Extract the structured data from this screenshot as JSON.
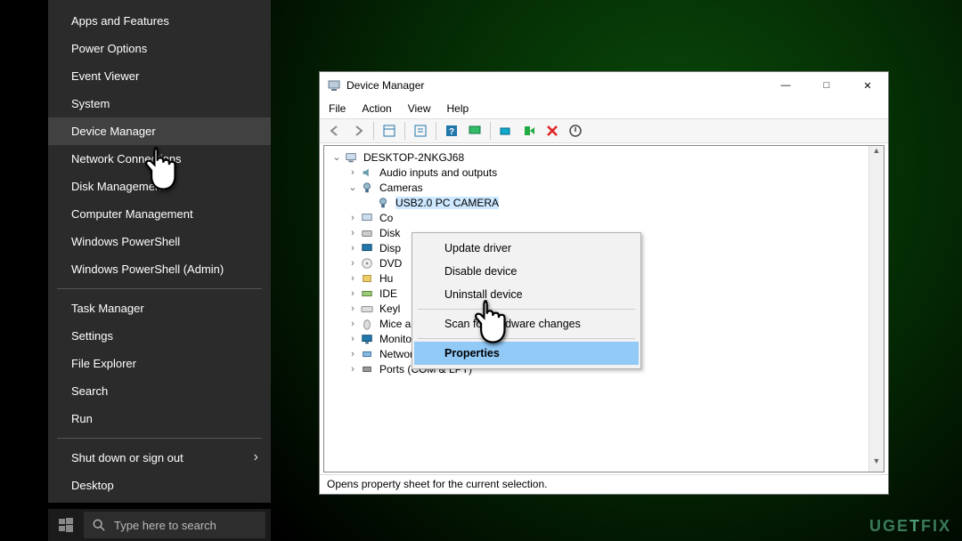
{
  "winx": {
    "items": [
      "Apps and Features",
      "Power Options",
      "Event Viewer",
      "System",
      "Device Manager",
      "Network Connections",
      "Disk Management",
      "Computer Management",
      "Windows PowerShell",
      "Windows PowerShell (Admin)"
    ],
    "group2": [
      "Task Manager",
      "Settings",
      "File Explorer",
      "Search",
      "Run"
    ],
    "group3": [
      "Shut down or sign out",
      "Desktop"
    ],
    "hovered_index": 4
  },
  "taskbar": {
    "search_placeholder": "Type here to search"
  },
  "dm": {
    "title": "Device Manager",
    "menu": [
      "File",
      "Action",
      "View",
      "Help"
    ],
    "root": "DESKTOP-2NKGJ68",
    "nodes": [
      {
        "label": "Audio inputs and outputs",
        "exp": "closed",
        "icon": "audio"
      },
      {
        "label": "Cameras",
        "exp": "open",
        "icon": "camera",
        "children": [
          {
            "label": "USB2.0 PC CAMERA",
            "icon": "camera",
            "selected": true
          }
        ]
      },
      {
        "label": "Computer",
        "exp": "closed",
        "icon": "computer",
        "trunc": "Co"
      },
      {
        "label": "Disk drives",
        "exp": "closed",
        "icon": "disk",
        "trunc": "Disk"
      },
      {
        "label": "Display adapters",
        "exp": "closed",
        "icon": "display",
        "trunc": "Disp"
      },
      {
        "label": "DVD/CD-ROM drives",
        "exp": "closed",
        "icon": "dvd",
        "trunc": "DVD"
      },
      {
        "label": "Human Interface Devices",
        "exp": "closed",
        "icon": "hid",
        "trunc": "Hu"
      },
      {
        "label": "IDE ATA/ATAPI controllers",
        "exp": "closed",
        "icon": "ide",
        "trunc": "IDE"
      },
      {
        "label": "Keyboards",
        "exp": "closed",
        "icon": "keyboard",
        "trunc": "Keyl"
      },
      {
        "label": "Mice and other pointing devices",
        "exp": "closed",
        "icon": "mouse"
      },
      {
        "label": "Monitors",
        "exp": "closed",
        "icon": "monitor"
      },
      {
        "label": "Network adapters",
        "exp": "closed",
        "icon": "network"
      },
      {
        "label": "Ports (COM & LPT)",
        "exp": "closed",
        "icon": "port"
      }
    ],
    "status": "Opens property sheet for the current selection."
  },
  "ctx": {
    "items": [
      "Update driver",
      "Disable device",
      "Uninstall device"
    ],
    "items2": [
      "Scan for hardware changes"
    ],
    "items3": [
      "Properties"
    ],
    "hovered": "Properties"
  },
  "watermark": "UGETFIX"
}
